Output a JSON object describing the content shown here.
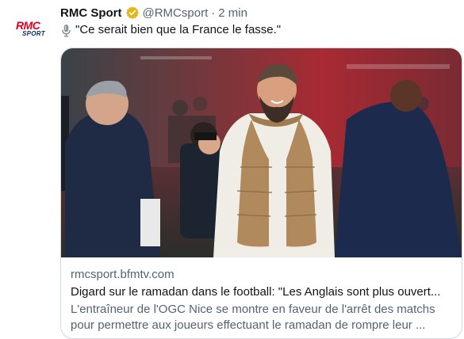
{
  "tweet": {
    "author_name": "RMC Sport",
    "handle": "@RMCsport",
    "separator": "·",
    "time": "2 min",
    "text": "\"Ce serait bien que la France le fasse.\"",
    "text_icon": "microphone-icon",
    "avatar": {
      "logo_top": "RMC",
      "logo_bottom": "SPORT"
    }
  },
  "card": {
    "domain": "rmcsport.bfmtv.com",
    "title": "Digard sur le ramadan dans le football: \"Les Anglais sont plus ouvert...",
    "description_line1": "L'entraîneur de l'OGC Nice se montre en faveur de l'arrêt des matchs",
    "description_line2": "pour permettre aux joueurs effectuant le ramadan de rompre leur ..."
  },
  "colors": {
    "brand_red": "#e2001a",
    "verified_gold": "#e2b719",
    "secondary_text": "#536471",
    "card_border": "#cfd9de"
  }
}
